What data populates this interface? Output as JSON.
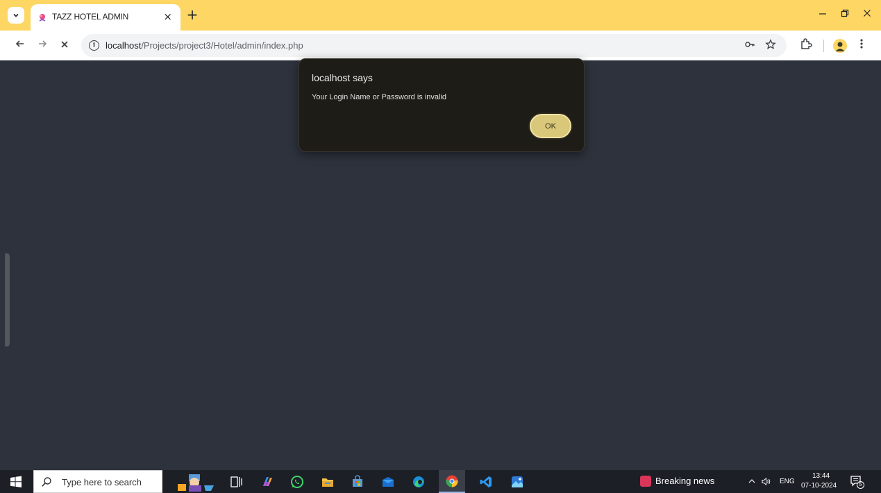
{
  "browser": {
    "tab_title": "TAZZ HOTEL ADMIN",
    "tab_close": "×",
    "new_tab": "+",
    "url_host": "localhost",
    "url_path": "/Projects/project3/Hotel/admin/index.php",
    "accent_color": "#fdd663"
  },
  "dialog": {
    "title": "localhost says",
    "message": "Your Login Name or Password is invalid",
    "ok_label": "OK"
  },
  "taskbar": {
    "search_placeholder": "Type here to search",
    "news_label": "Breaking news",
    "language": "ENG",
    "time": "13:44",
    "date": "07-10-2024",
    "notification_count": "5"
  }
}
